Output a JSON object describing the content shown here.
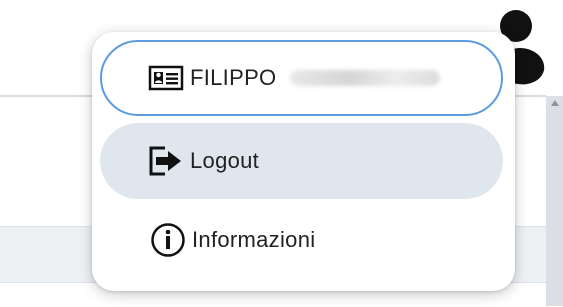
{
  "user_menu": {
    "user_name": "FILIPPO",
    "logout_label": "Logout",
    "info_label": "Informazioni"
  },
  "icons": {
    "user_card": "id-card-icon",
    "logout": "logout-icon",
    "info": "info-circle-icon",
    "avatar": "user-avatar-icon"
  },
  "colors": {
    "active_border": "#5b9be0",
    "hover_bg": "#dfe6ee"
  }
}
